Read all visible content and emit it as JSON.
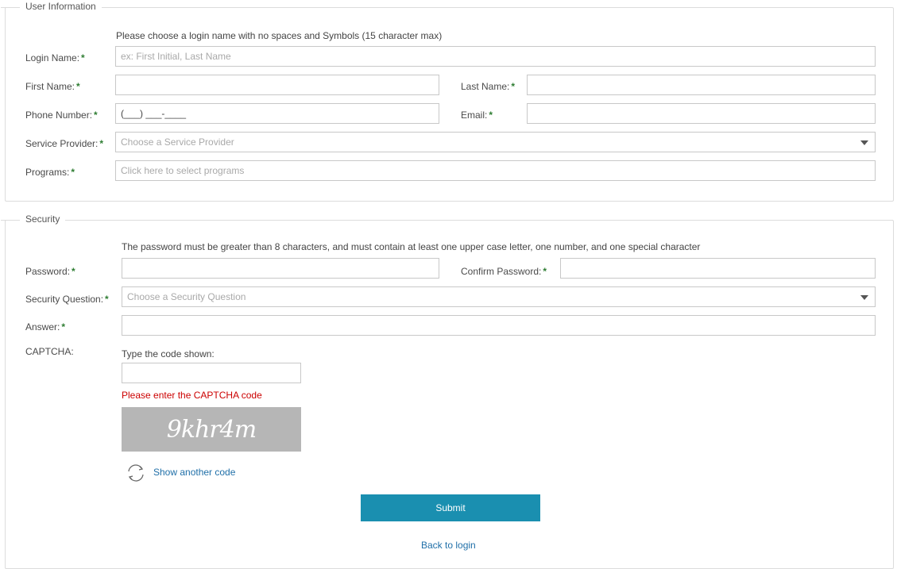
{
  "user_info": {
    "legend": "User Information",
    "login_hint": "Please choose a login name with no spaces and Symbols (15 character max)",
    "login_label": "Login Name:",
    "login_placeholder": "ex: First Initial, Last Name",
    "first_label": "First Name:",
    "last_label": "Last Name:",
    "phone_label": "Phone Number:",
    "phone_value": "(___) ___-____",
    "email_label": "Email:",
    "provider_label": "Service Provider:",
    "provider_value": "Choose a Service Provider",
    "programs_label": "Programs:",
    "programs_placeholder": "Click here to select programs",
    "required_mark": "*"
  },
  "security": {
    "legend": "Security",
    "password_hint": "The password must be greater than 8 characters, and must contain at least one upper case letter, one number, and one special character",
    "password_label": "Password:",
    "confirm_label": "Confirm Password:",
    "question_label": "Security Question:",
    "question_value": "Choose a Security Question",
    "answer_label": "Answer:",
    "captcha_label": "CAPTCHA:",
    "captcha_prompt": "Type the code shown:",
    "captcha_error": "Please enter the CAPTCHA code",
    "captcha_text": "9khr4m",
    "another_code": "Show another code"
  },
  "actions": {
    "submit": "Submit",
    "back": "Back to login"
  },
  "colors": {
    "accent": "#1a8fb0",
    "required": "#2e7d32",
    "error": "#cc0000",
    "link": "#1f6fa8"
  }
}
